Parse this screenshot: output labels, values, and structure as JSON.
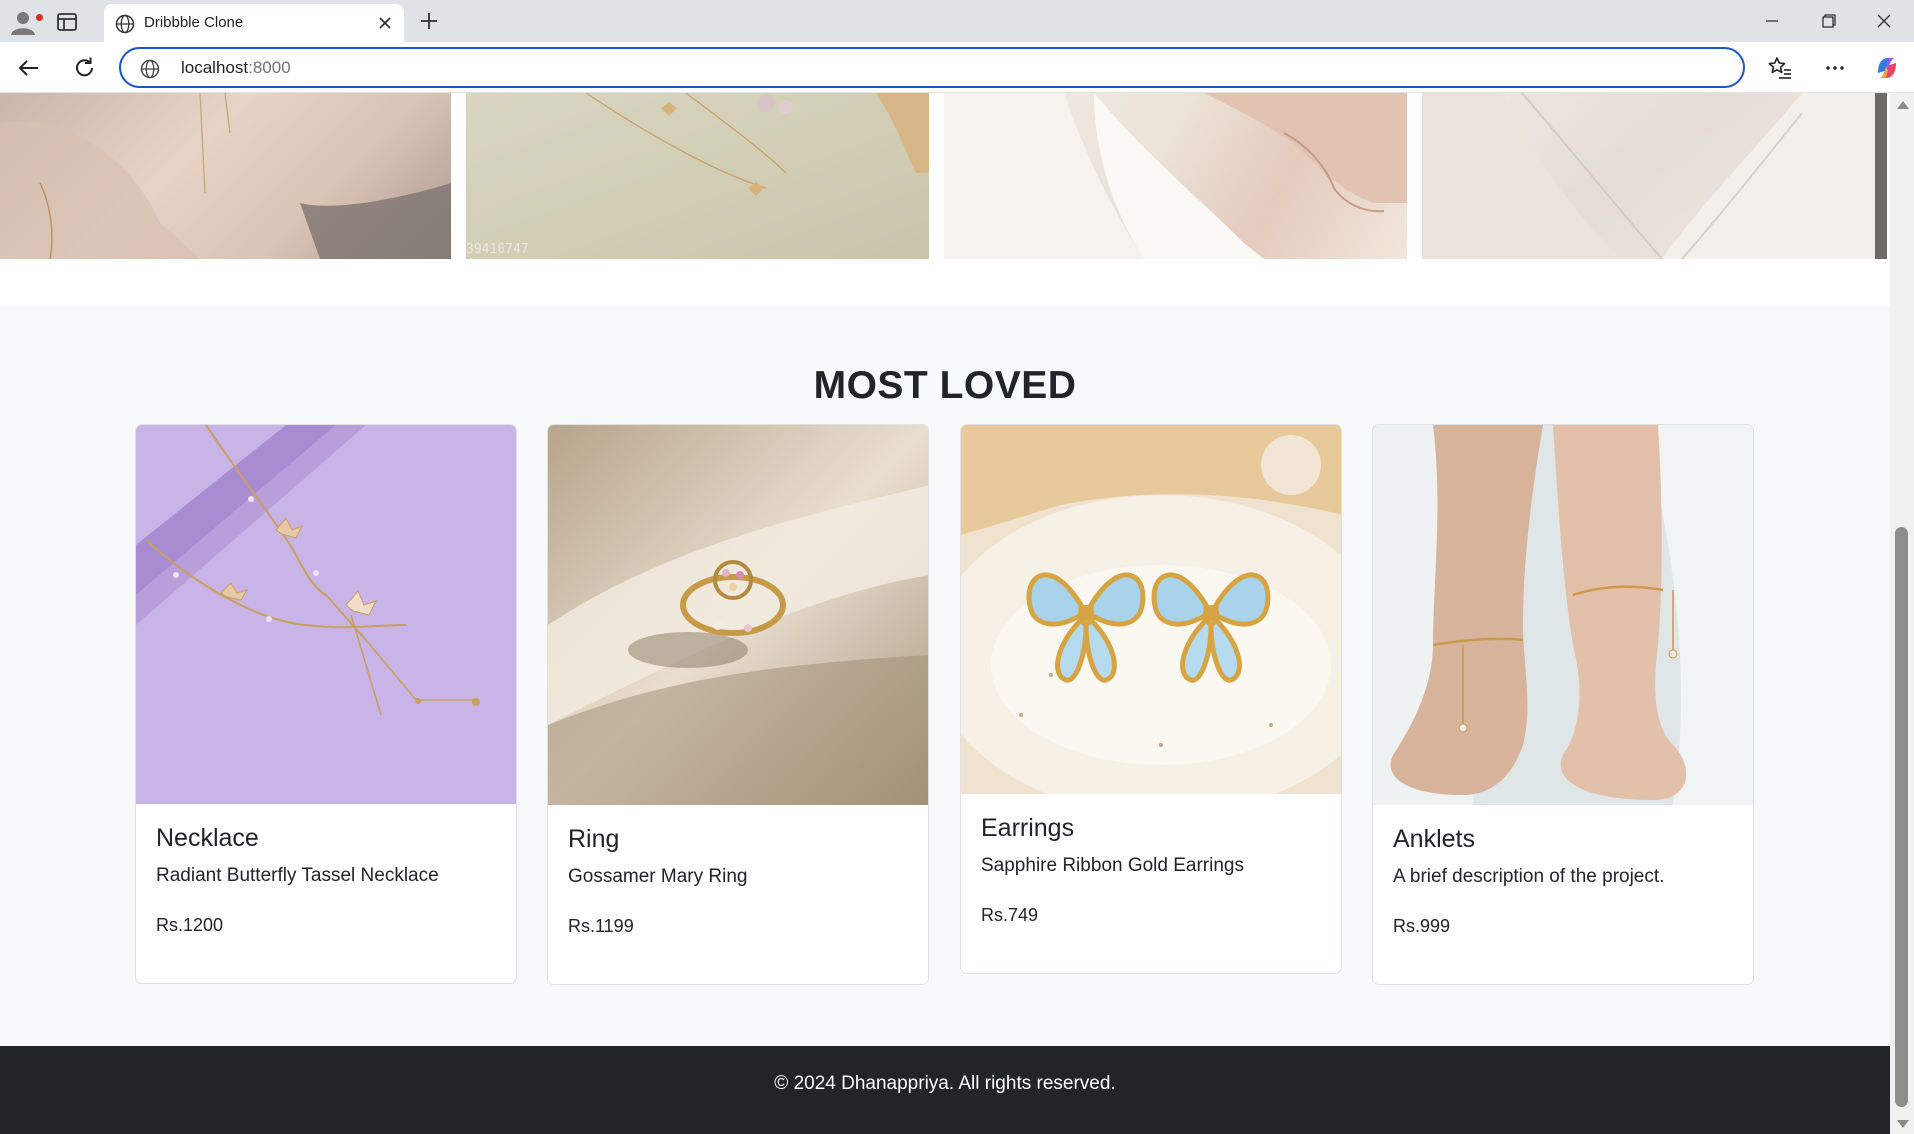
{
  "browser": {
    "tab_title": "Dribbble Clone",
    "url_host": "localhost",
    "url_port": ":8000"
  },
  "hero": {
    "watermark": "39416747"
  },
  "section": {
    "title": "MOST LOVED"
  },
  "products": [
    {
      "name": "Necklace",
      "description": "Radiant Butterfly Tassel Necklace",
      "price": "Rs.1200"
    },
    {
      "name": "Ring",
      "description": "Gossamer Mary Ring",
      "price": "Rs.1199"
    },
    {
      "name": "Earrings",
      "description": "Sapphire Ribbon Gold Earrings",
      "price": "Rs.749"
    },
    {
      "name": "Anklets",
      "description": "A brief description of the project.",
      "price": "Rs.999"
    }
  ],
  "footer": {
    "text": "© 2024 Dhanappriya. All rights reserved."
  },
  "colors": {
    "omnibox_border": "#1a56c9",
    "footer_bg": "#212529",
    "page_bg": "#f8f9fa"
  }
}
